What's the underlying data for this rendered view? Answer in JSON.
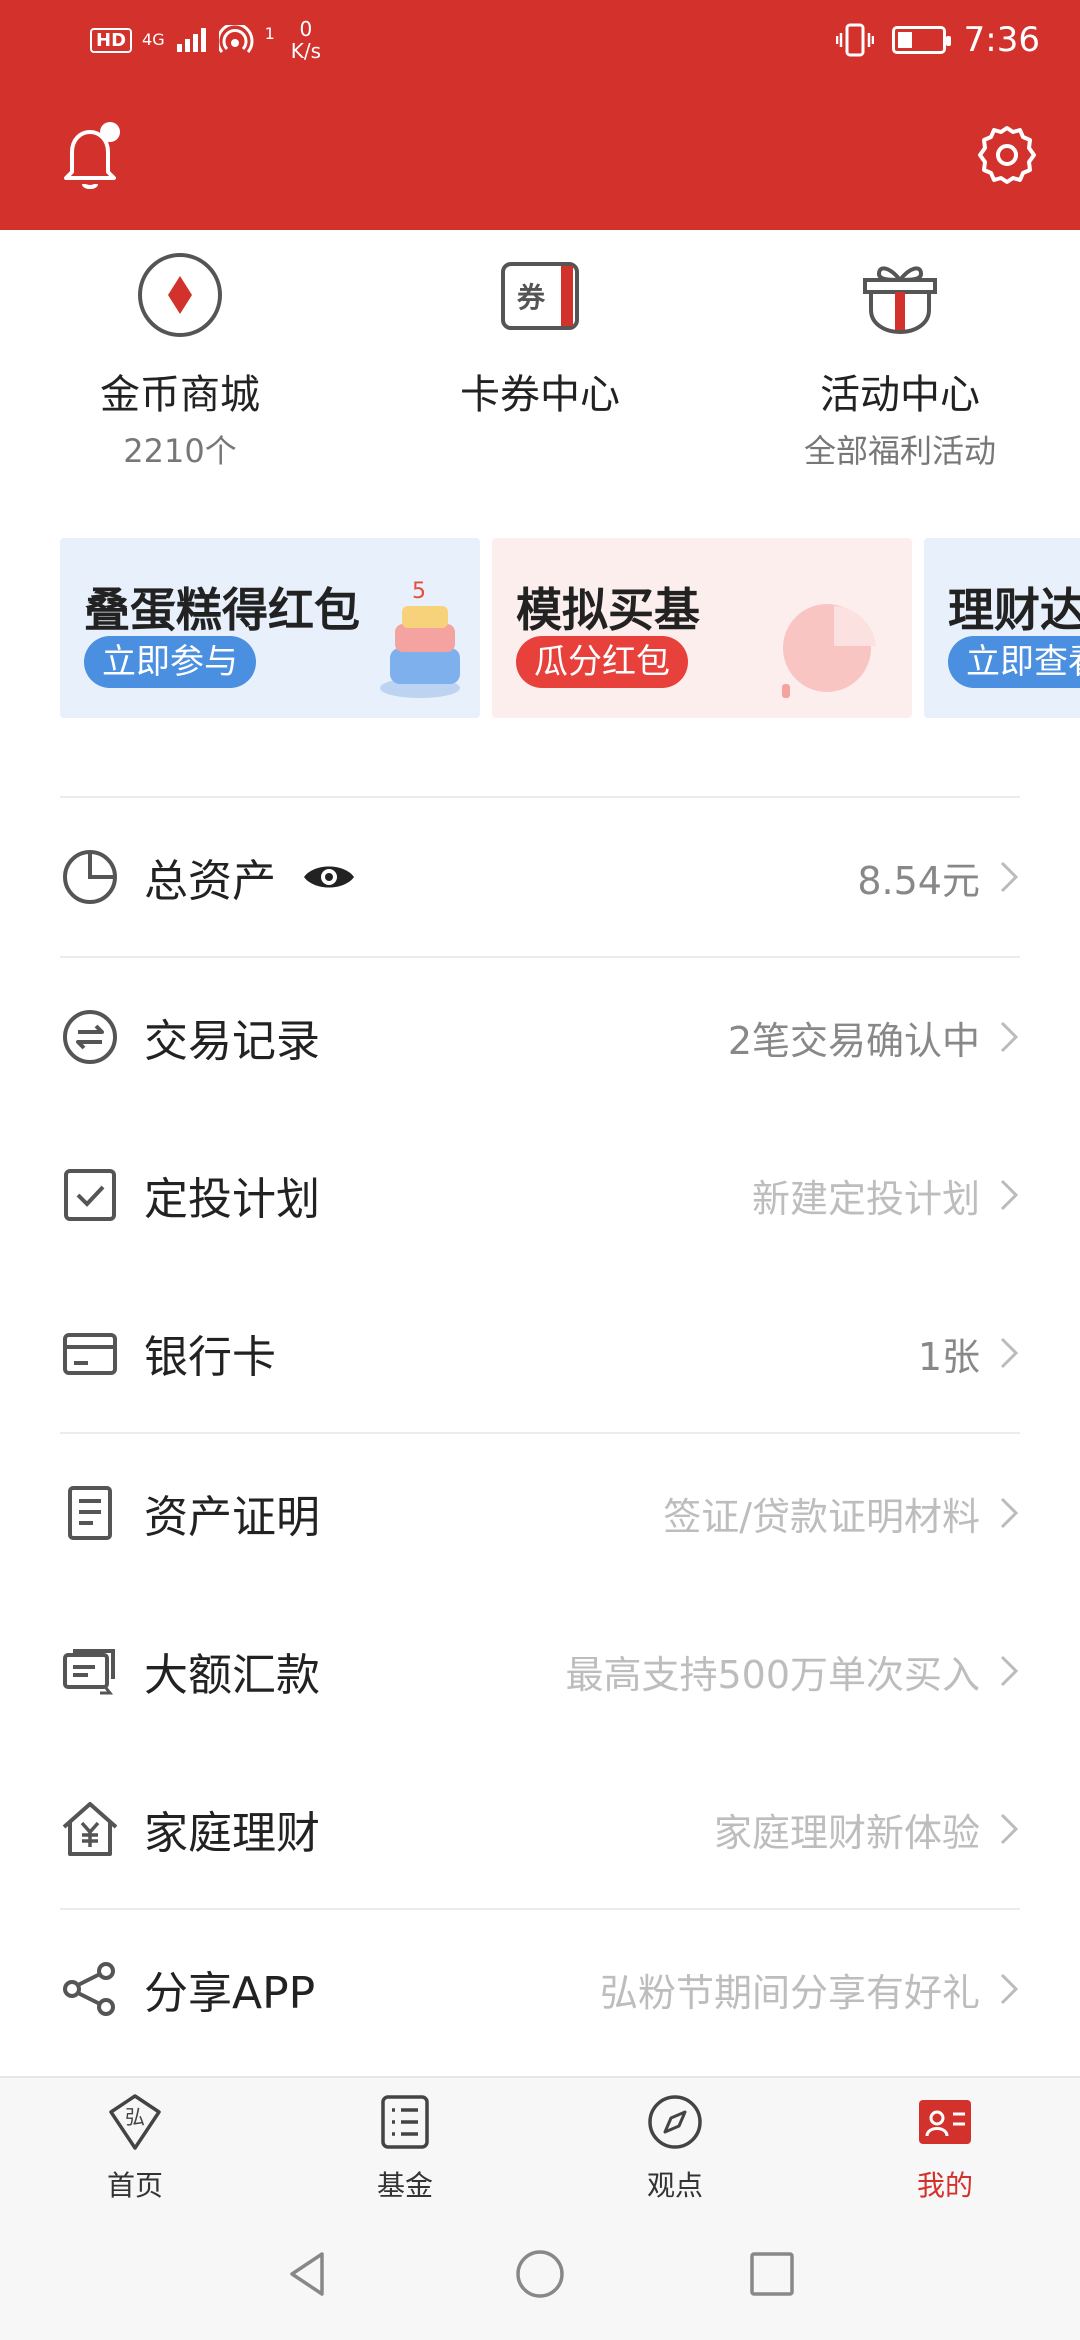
{
  "status_bar": {
    "hd": "HD",
    "network": "4G",
    "net_speed_value": "0",
    "net_speed_unit": "K/s",
    "wifi_badge": "1",
    "time": "7:36"
  },
  "quick_entries": [
    {
      "title": "金币商城",
      "subtitle": "2210个",
      "icon": "diamond-coin-icon"
    },
    {
      "title": "卡券中心",
      "subtitle": "",
      "icon_text": "券",
      "icon": "coupon-icon"
    },
    {
      "title": "活动中心",
      "subtitle": "全部福利活动",
      "icon": "gift-icon"
    }
  ],
  "banners": [
    {
      "title": "叠蛋糕得红包",
      "button": "立即参与",
      "accent": "#4a8fe0"
    },
    {
      "title": "模拟买基",
      "button": "瓜分红包",
      "accent": "#e8403a"
    },
    {
      "title": "理财达",
      "button": "立即查看",
      "accent": "#4a8fe0"
    }
  ],
  "list": [
    {
      "label": "总资产",
      "value": "8.54元",
      "icon": "pie-chart-icon",
      "has_eye": true
    },
    {
      "label": "交易记录",
      "value": "2笔交易确认中",
      "icon": "exchange-icon"
    },
    {
      "label": "定投计划",
      "value": "新建定投计划",
      "icon": "checkbox-icon"
    },
    {
      "label": "银行卡",
      "value": "1张",
      "icon": "bank-card-icon"
    },
    {
      "label": "资产证明",
      "value": "签证/贷款证明材料",
      "icon": "document-icon"
    },
    {
      "label": "大额汇款",
      "value": "最高支持500万单次买入",
      "icon": "transfer-icon"
    },
    {
      "label": "家庭理财",
      "value": "家庭理财新体验",
      "icon": "home-yuan-icon"
    },
    {
      "label": "分享APP",
      "value": "弘粉节期间分享有好礼",
      "icon": "share-icon"
    }
  ],
  "bottom_nav": [
    {
      "label": "首页",
      "icon_text": "弘",
      "icon": "home-diamond-icon",
      "active": false
    },
    {
      "label": "基金",
      "icon": "list-icon",
      "active": false
    },
    {
      "label": "观点",
      "icon": "compass-icon",
      "active": false
    },
    {
      "label": "我的",
      "icon": "profile-card-icon",
      "active": true
    }
  ],
  "colors": {
    "brand": "#d3312b",
    "link_blue": "#4a8fe0"
  }
}
